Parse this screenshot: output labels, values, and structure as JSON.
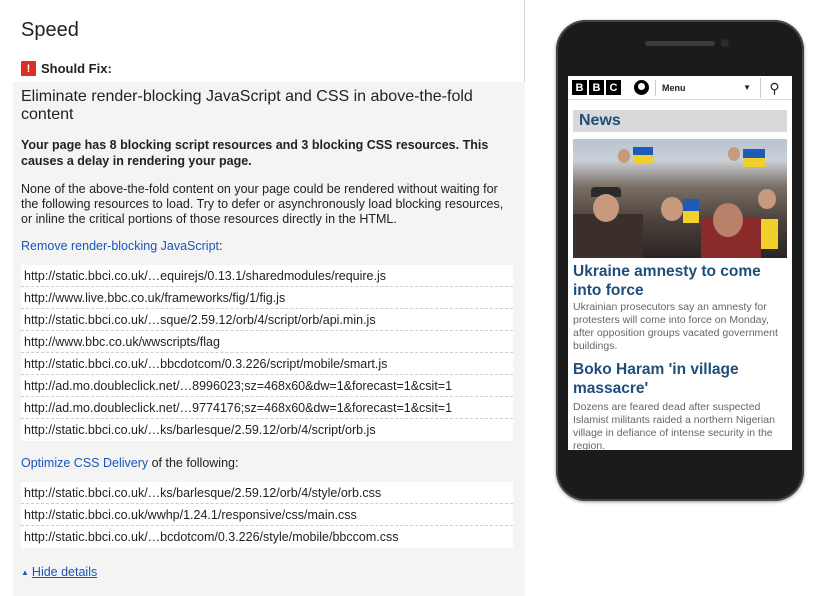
{
  "left_panel": {
    "section_title": "Speed",
    "status_label": "Should Fix:",
    "status_icon": "exclamation-icon",
    "rule": {
      "title": "Eliminate render-blocking JavaScript and CSS in above-the-fold content",
      "summary_bold": "Your page has 8 blocking script resources and 3 blocking CSS resources. This causes a delay in rendering your page.",
      "description": "None of the above-the-fold content on your page could be rendered without waiting for the following resources to load. Try to defer or asynchronously load blocking resources, or inline the critical portions of those resources directly in the HTML.",
      "js_link": "Remove render-blocking JavaScript",
      "js_link_suffix": ":",
      "js_urls": [
        "http://static.bbci.co.uk/…equirejs/0.13.1/sharedmodules/require.js",
        "http://www.live.bbc.co.uk/frameworks/fig/1/fig.js",
        "http://static.bbci.co.uk/…sque/2.59.12/orb/4/script/orb/api.min.js",
        "http://www.bbc.co.uk/wwscripts/flag",
        "http://static.bbci.co.uk/…bbcdotcom/0.3.226/script/mobile/smart.js",
        "http://ad.mo.doubleclick.net/…8996023;sz=468x60&dw=1&forecast=1&csit=1",
        "http://ad.mo.doubleclick.net/…9774176;sz=468x60&dw=1&forecast=1&csit=1",
        "http://static.bbci.co.uk/…ks/barlesque/2.59.12/orb/4/script/orb.js"
      ],
      "css_link": "Optimize CSS Delivery",
      "css_link_suffix": " of the following:",
      "css_urls": [
        "http://static.bbci.co.uk/…ks/barlesque/2.59.12/orb/4/style/orb.css",
        "http://static.bbci.co.uk/wwhp/1.24.1/responsive/css/main.css",
        "http://static.bbci.co.uk/…bcdotcom/0.3.226/style/mobile/bbccom.css"
      ],
      "hide_details": "Hide details"
    }
  },
  "phone_preview": {
    "logo_letters": [
      "B",
      "B",
      "C"
    ],
    "menu_label": "Menu",
    "section_label": "News",
    "stories": [
      {
        "headline": "Ukraine amnesty to come into force",
        "summary": "Ukrainian prosecutors say an amnesty for protesters will come into force on Monday, after opposition groups vacated government buildings."
      },
      {
        "headline": "Boko Haram 'in village massacre'",
        "summary": "Dozens are feared dead after suspected Islamist militants raided a northern Nigerian village in defiance of intense security in the region."
      }
    ]
  },
  "colors": {
    "link": "#1a55b6",
    "warning": "#d93025",
    "bbc_headline": "#1f4e79"
  }
}
